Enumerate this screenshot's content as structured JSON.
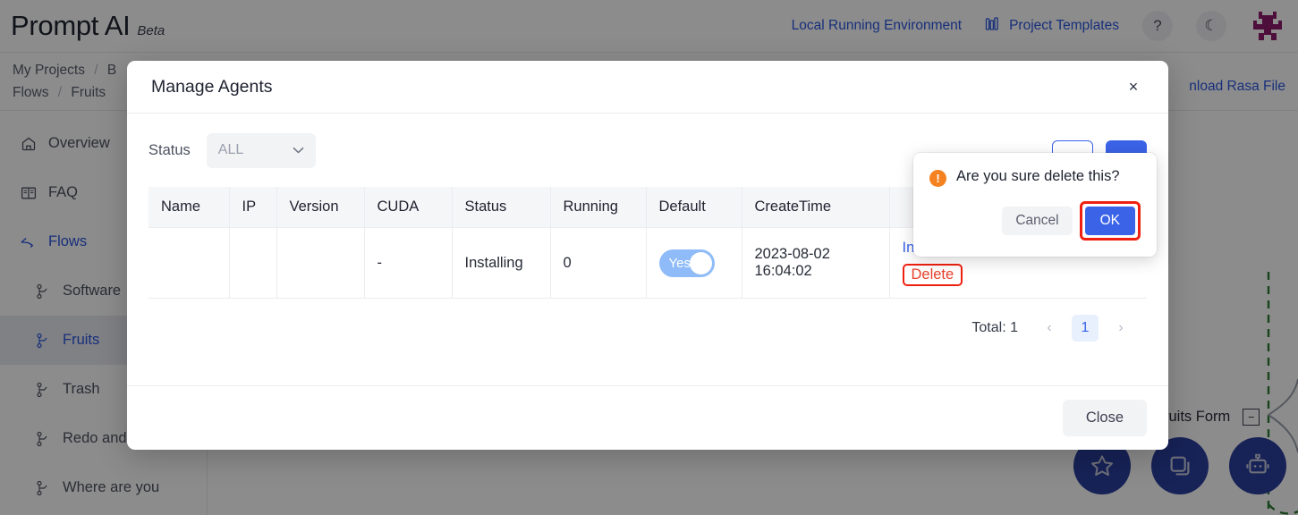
{
  "app": {
    "brand_title": "Prompt AI",
    "brand_beta": "Beta"
  },
  "header": {
    "local_env_link": "Local Running Environment",
    "project_templates_link": "Project Templates",
    "help_icon": "?",
    "dark_mode_icon": "☾",
    "accent_blue": "#2b56e0"
  },
  "breadcrumb": {
    "line1_item1": "My Projects",
    "line1_sep": "/",
    "line1_item2": "B",
    "line2_item1": "Flows",
    "line2_sep": "/",
    "line2_item2": "Fruits",
    "download_link": "nload Rasa File"
  },
  "sidebar": {
    "items": [
      {
        "label": "Overview",
        "icon": "home-icon",
        "level": 0,
        "active": false,
        "selected": false
      },
      {
        "label": "FAQ",
        "icon": "book-icon",
        "level": 0,
        "active": false,
        "selected": false
      },
      {
        "label": "Flows",
        "icon": "flow-icon",
        "level": 0,
        "active": true,
        "selected": false
      },
      {
        "label": "Software",
        "icon": "branch-icon",
        "level": 1,
        "active": false,
        "selected": false
      },
      {
        "label": "Fruits",
        "icon": "branch-icon",
        "level": 1,
        "active": true,
        "selected": true
      },
      {
        "label": "Trash",
        "icon": "branch-icon",
        "level": 1,
        "active": false,
        "selected": false
      },
      {
        "label": "Redo and",
        "icon": "branch-icon",
        "level": 1,
        "active": false,
        "selected": false
      },
      {
        "label": "Where are you",
        "icon": "branch-icon",
        "level": 1,
        "active": false,
        "selected": false
      }
    ]
  },
  "canvas": {
    "node_label": "ruits Form",
    "collapse_glyph": "−",
    "fab_buttons": [
      {
        "icon": "star-icon"
      },
      {
        "icon": "copy-icon"
      },
      {
        "icon": "robot-icon"
      }
    ],
    "fab_color": "#2b3f9e"
  },
  "modal": {
    "title": "Manage Agents",
    "close_icon": "×",
    "close_button": "Close",
    "filter": {
      "label": "Status",
      "select_value": "ALL",
      "caret": "⌄"
    },
    "actions": {
      "secondary_label": "",
      "primary_label": ""
    },
    "table": {
      "columns": [
        "Name",
        "IP",
        "Version",
        "CUDA",
        "Status",
        "Running",
        "Default",
        "CreateTime",
        ""
      ],
      "rows": [
        {
          "name": "",
          "ip": "",
          "version": "",
          "cuda": "-",
          "status": "Installing",
          "running": "0",
          "default_label": "Yes",
          "default_on": true,
          "create_time": "2023-08-02 16:04:02",
          "action_install": "Install Agent",
          "action_delete": "Delete"
        }
      ]
    },
    "pagination": {
      "total": "Total: 1",
      "prev": "‹",
      "page": "1",
      "next": "›"
    }
  },
  "confirm_popover": {
    "warn_icon": "!",
    "message": "Are you sure delete this?",
    "cancel_label": "Cancel",
    "ok_label": "OK",
    "highlight_color": "#ef2010",
    "ok_color": "#3b63e8"
  }
}
